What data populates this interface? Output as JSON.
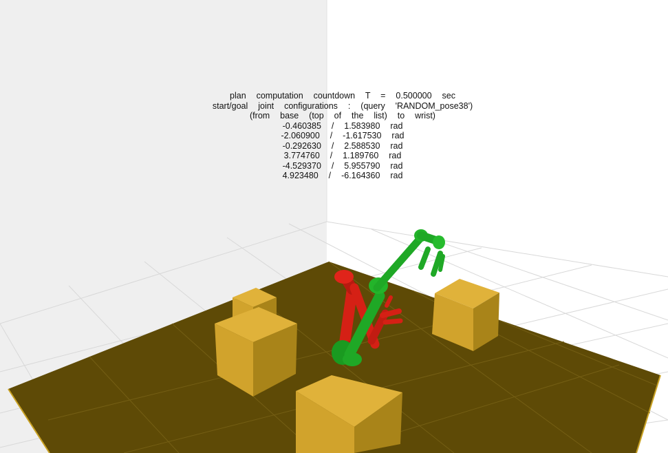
{
  "overlay": {
    "countdown": "plan  computation  countdown  T  =  0.500000  sec",
    "query": "start/goal  joint  configurations  :  (query  'RANDOM_pose38')",
    "order_note": "(from  base  (top  of  the  list)  to  wrist)",
    "joints": [
      "-0.460385  /  1.583980  rad",
      "-2.060900  /  -1.617530  rad",
      "-0.292630  /  2.588530  rad",
      "3.774760  /  1.189760  rad",
      "-4.529370  /  5.955790  rad",
      "4.923480  /  -6.164360  rad"
    ]
  },
  "colors": {
    "background_left_wall": "#efefef",
    "background_right": "#ffffff",
    "floor": "#5e4a06",
    "box_light": "#e0b23a",
    "box_mid": "#d1a32c",
    "box_dark": "#a98419",
    "start_arm": "#1fa826",
    "goal_arm": "#d52015"
  }
}
